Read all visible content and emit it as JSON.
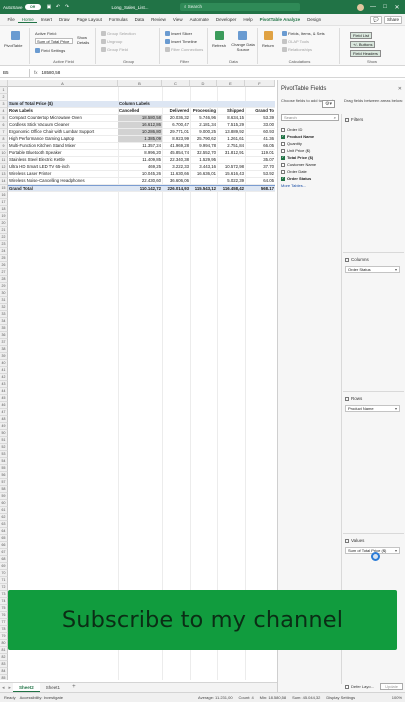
{
  "titlebar": {
    "autosave_label": "AutoSave",
    "autosave_state": "Off",
    "filename": "Long_Sales_List...",
    "search_placeholder": "Search",
    "window_controls": [
      "—",
      "□",
      "✕"
    ]
  },
  "menu": {
    "tabs": [
      "File",
      "Home",
      "Insert",
      "Draw",
      "Page Layout",
      "Formulas",
      "Data",
      "Review",
      "View",
      "Automate",
      "Developer",
      "Help",
      "PivotTable Analyze",
      "Design"
    ],
    "active": "Home",
    "tool_tabs": [
      "PivotTable Analyze",
      "Design"
    ],
    "right_buttons": [
      "💬",
      "Share"
    ]
  },
  "ribbon": {
    "pivottable_label": "PivotTable",
    "active_field_label": "Active Field:",
    "active_field_value": "Sum of Total Price",
    "field_settings_label": "Field Settings",
    "drill_label": "Show Details",
    "group_selection": "Group Selection",
    "ungroup": "Ungroup",
    "group_field": "Group Field",
    "insert_slicer": "Insert Slicer",
    "insert_timeline": "Insert Timeline",
    "filter_connections": "Filter Connections",
    "refresh_label": "Refresh",
    "change_source_label": "Change Data Source",
    "return_label": "Return",
    "fields_items": "Fields, Items, & Sets",
    "olap_tools": "OLAP Tools",
    "relationships": "Relationships",
    "field_list": "Field List",
    "buttons": "+/- Buttons",
    "field_headers": "Field Headers",
    "groups": [
      "Active Field",
      "Group",
      "Filter",
      "Data",
      "Calculations",
      "Show"
    ]
  },
  "formula_bar": {
    "name_box": "B5",
    "fx": "fx",
    "value": "18580,58"
  },
  "grid": {
    "columns": [
      "A",
      "B",
      "C",
      "D",
      "E",
      "F"
    ],
    "header_row": {
      "label": "Sum of Total Price ($)",
      "col_labels": "Column Labels"
    },
    "labels_row": [
      "Row Labels",
      "Cancelled",
      "Delivered",
      "Processing",
      "Shipped",
      "Grand To"
    ],
    "rows": [
      [
        "Compact Countertop Microwave Oven",
        "18.580,58",
        "20.036,32",
        "5.746,96",
        "8.634,15",
        "53.39"
      ],
      [
        "Cordless Stick Vacuum Cleaner",
        "16.612,86",
        "6.700,47",
        "2.181,34",
        "7.515,29",
        "33.00"
      ],
      [
        "Ergonomic Office Chair with Lumbar Support",
        "10.286,80",
        "29.771,01",
        "9.000,25",
        "13.889,92",
        "60.93"
      ],
      [
        "High Performance Gaming Laptop",
        "1.385,09",
        "8.923,99",
        "25.790,62",
        "1.261,61",
        "41.36"
      ],
      [
        "Multi-Function Kitchen Stand Mixer",
        "11.357,24",
        "41.969,28",
        "9.994,78",
        "2.751,84",
        "66.05"
      ],
      [
        "Portable Bluetooth Speaker",
        "8.996,20",
        "45.854,74",
        "32.552,70",
        "31.812,91",
        "119.01"
      ],
      [
        "Stainless Steel Electric Kettle",
        "11.409,85",
        "22.340,38",
        "1.529,95",
        "",
        "35.07"
      ],
      [
        "Ultra HD Smart LED TV 65-inch",
        "469,25",
        "3.222,33",
        "3.443,16",
        "10.572,98",
        "37.70"
      ],
      [
        "Wireless Laser Printer",
        "10.045,26",
        "11.630,66",
        "16.636,01",
        "15.616,43",
        "53.92"
      ],
      [
        "Wireless Noise-Cancelling Headphones",
        "22.430,60",
        "36.606,06",
        "",
        "5.022,39",
        "64.05"
      ]
    ],
    "total_row": [
      "Grand Total",
      "110.142,72",
      "226.014,93",
      "115.543,12",
      "116.458,42",
      "568.17"
    ],
    "row_numbers": [
      "1",
      "2",
      "3",
      "4",
      "5",
      "6",
      "7",
      "8",
      "9",
      "10",
      "11",
      "12",
      "13",
      "14",
      "15",
      "16",
      "17",
      "18",
      "19",
      "20",
      "21",
      "22",
      "23",
      "24",
      "25",
      "26",
      "27",
      "28",
      "29",
      "30",
      "31",
      "32",
      "33",
      "34",
      "35",
      "36",
      "37",
      "38",
      "39",
      "40",
      "41",
      "42",
      "43",
      "44",
      "45",
      "46",
      "47",
      "48",
      "49",
      "50",
      "51",
      "52",
      "53",
      "54",
      "55",
      "56",
      "57",
      "58",
      "59",
      "60",
      "61",
      "62",
      "63",
      "64",
      "65",
      "66",
      "67",
      "68",
      "69",
      "70",
      "71",
      "72",
      "73",
      "74",
      "75",
      "76",
      "77",
      "78",
      "79",
      "80",
      "81",
      "82",
      "83",
      "84",
      "85"
    ]
  },
  "pane": {
    "title": "PivotTable Fields",
    "choose_text": "Choose fields to add to report:",
    "drag_text": "Drag fields between areas below:",
    "search_placeholder": "Search",
    "fields": [
      {
        "name": "Order ID",
        "checked": false
      },
      {
        "name": "Product Name",
        "checked": true
      },
      {
        "name": "Quantity",
        "checked": false
      },
      {
        "name": "Unit Price ($)",
        "checked": false
      },
      {
        "name": "Total Price ($)",
        "checked": true
      },
      {
        "name": "Customer Name",
        "checked": false
      },
      {
        "name": "Order Date",
        "checked": false
      },
      {
        "name": "Order Status",
        "checked": true
      }
    ],
    "more_tables": "More Tables...",
    "filters_label": "Filters",
    "columns_label": "Columns",
    "columns_chip": "Order Status",
    "rows_label": "Rows",
    "rows_chip": "Product Name",
    "values_label": "Values",
    "values_chip": "Sum of Total Price ($)",
    "defer_label": "Defer Layo...",
    "update_label": "Update"
  },
  "banner": {
    "text": "Subscribe to my channel",
    "color": "#119c3e"
  },
  "sheets": {
    "tabs": [
      "Sheet2",
      "Sheet1"
    ],
    "active": "Sheet2",
    "add": "+"
  },
  "status": {
    "ready": "Ready",
    "accessibility": "Accessibility: Investigate",
    "average": "Average: 11.231,00",
    "count": "Count: 4",
    "min": "Min: 18.580,58",
    "sum": "Sum: 45.044,32",
    "display": "Display Settings",
    "zoom": "100%"
  }
}
